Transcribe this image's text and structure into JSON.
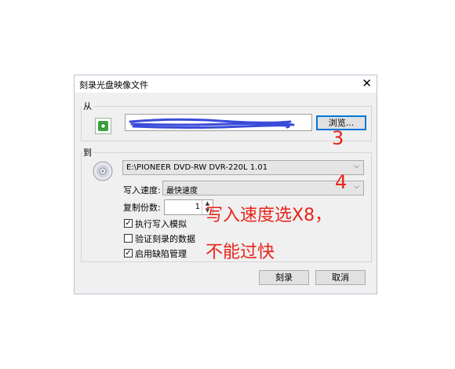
{
  "dialog": {
    "title": "刻录光盘映像文件",
    "close_glyph": "✕",
    "from": {
      "label": "从",
      "browse_label": "浏览..."
    },
    "to": {
      "label": "到",
      "drive": "E:\\PIONEER DVD-RW DVR-220L 1.01",
      "speed_label": "写入速度:",
      "speed_value": "最快速度",
      "copies_label": "复制份数:",
      "copies_value": "1",
      "options": [
        {
          "label": "执行写入模拟",
          "checked": true
        },
        {
          "label": "验证刻录的数据",
          "checked": false
        },
        {
          "label": "启用缺陷管理",
          "checked": true
        }
      ]
    },
    "burn_label": "刻录",
    "cancel_label": "取消"
  },
  "annotations": {
    "step3": "3",
    "step4": "4",
    "note_line1": "写入速度选X8，",
    "note_line2": "不能过快"
  },
  "colors": {
    "annotation": "#e8241a",
    "scribble": "#3a4bd8",
    "focus": "#0078d7"
  }
}
